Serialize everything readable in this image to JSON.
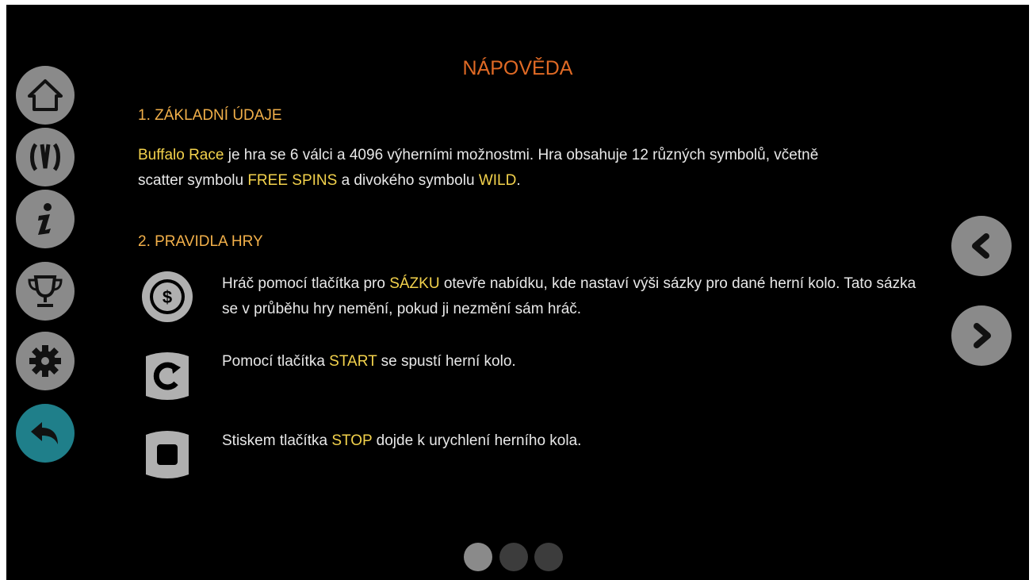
{
  "title": "NÁPOVĚDA",
  "sidebar": {
    "items": [
      {
        "icon": "home-icon"
      },
      {
        "icon": "paytable-icon"
      },
      {
        "icon": "info-icon"
      },
      {
        "icon": "trophy-icon"
      },
      {
        "icon": "gear-icon"
      },
      {
        "icon": "back-arrow-icon",
        "active": true
      }
    ]
  },
  "section1": {
    "heading": "1. ZÁKLADNÍ ÚDAJE",
    "parts": [
      {
        "text": "Buffalo Race",
        "hl": true
      },
      {
        "text": " je hra se 6 válci a 4096 výherními možnostmi. Hra obsahuje 12 různých symbolů, včetně scatter symbolu ",
        "hl": false
      },
      {
        "text": "FREE SPINS",
        "hl": true
      },
      {
        "text": " a divokého symbolu ",
        "hl": false
      },
      {
        "text": "WILD",
        "hl": true
      },
      {
        "text": ".",
        "hl": false
      }
    ]
  },
  "section2": {
    "heading": "2. PRAVIDLA HRY",
    "rules": [
      {
        "icon": "bet-coin-icon",
        "parts": [
          {
            "text": "Hráč pomocí tlačítka pro ",
            "hl": false
          },
          {
            "text": "SÁZKU",
            "hl": true
          },
          {
            "text": " otevře nabídku, kde nastaví výši sázky pro dané herní kolo. Tato sázka se v průběhu hry nemění, pokud ji nezmění sám hráč.",
            "hl": false
          }
        ]
      },
      {
        "icon": "spin-icon",
        "parts": [
          {
            "text": "Pomocí tlačítka ",
            "hl": false
          },
          {
            "text": "START",
            "hl": true
          },
          {
            "text": " se spustí herní kolo.",
            "hl": false
          }
        ]
      },
      {
        "icon": "stop-icon",
        "parts": [
          {
            "text": "Stiskem tlačítka ",
            "hl": false
          },
          {
            "text": "STOP",
            "hl": true
          },
          {
            "text": " dojde k urychlení herního kola.",
            "hl": false
          }
        ]
      }
    ]
  },
  "nav": {
    "prev_icon": "chevron-left-icon",
    "next_icon": "chevron-right-icon"
  },
  "pagination": {
    "pages": 3,
    "current": 1
  },
  "colors": {
    "title": "#e06a25",
    "heading": "#f2b04a",
    "highlight": "#f3d24c",
    "text": "#e8e8e8",
    "button": "#8a8a8a",
    "active_button": "#1f7f8a"
  }
}
